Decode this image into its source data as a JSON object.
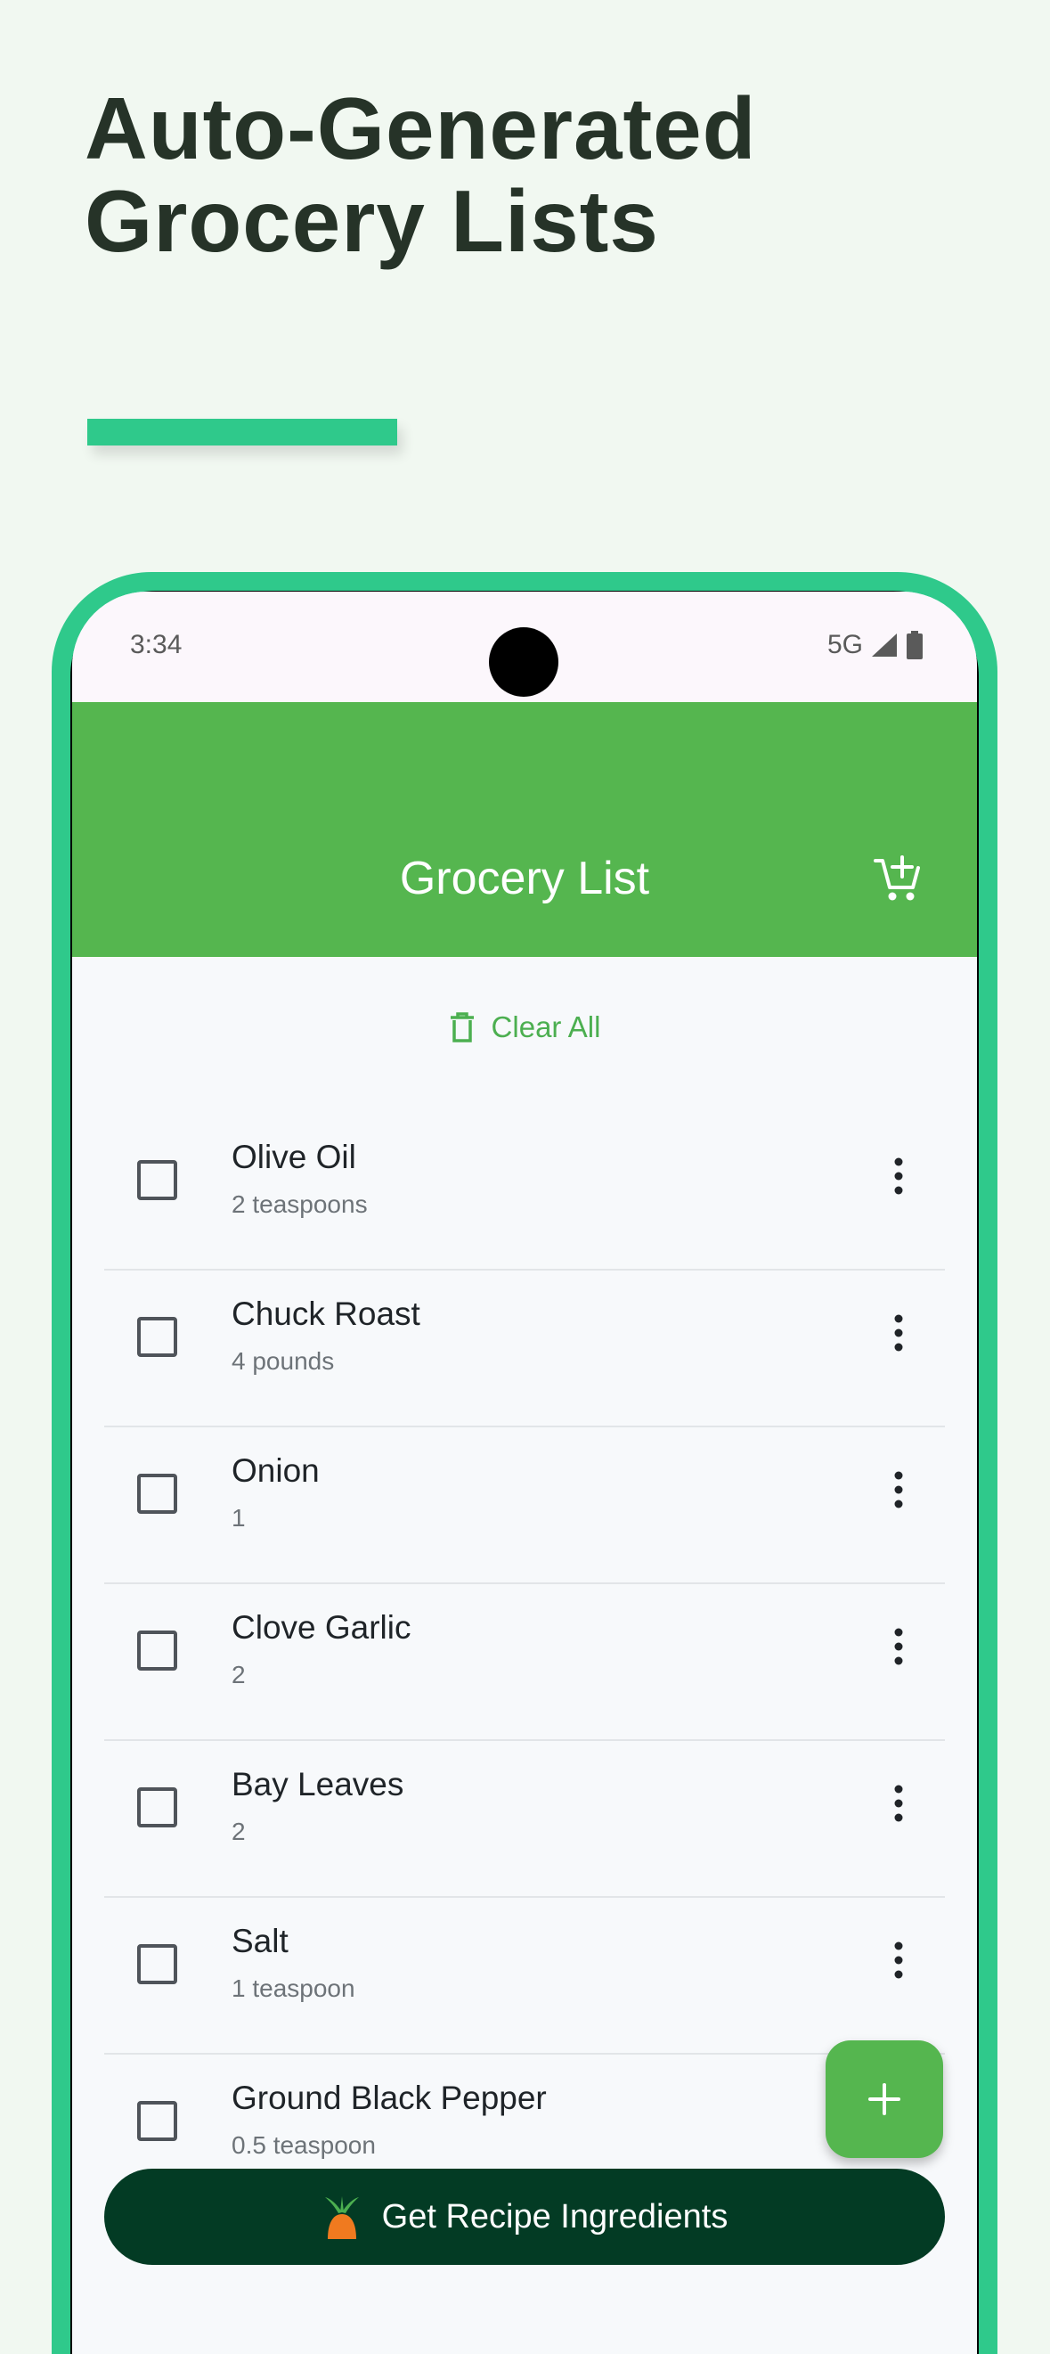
{
  "promo": {
    "title_line1": "Auto-Generated",
    "title_line2": "Grocery Lists"
  },
  "status_bar": {
    "time": "3:34",
    "network": "5G",
    "icons": [
      "signal-icon",
      "battery-icon"
    ]
  },
  "app_bar": {
    "title": "Grocery List",
    "action_icon": "add-cart-icon"
  },
  "clear_all": {
    "label": "Clear All",
    "icon": "trash-icon"
  },
  "items": [
    {
      "name": "Olive Oil",
      "quantity": "2 teaspoons"
    },
    {
      "name": "Chuck Roast",
      "quantity": "4 pounds"
    },
    {
      "name": "Onion",
      "quantity": "1"
    },
    {
      "name": "Clove Garlic",
      "quantity": "2"
    },
    {
      "name": "Bay Leaves",
      "quantity": "2"
    },
    {
      "name": "Salt",
      "quantity": "1 teaspoon"
    },
    {
      "name": "Ground Black Pepper",
      "quantity": "0.5 teaspoon"
    }
  ],
  "fab": {
    "icon": "plus-icon"
  },
  "cta": {
    "label": "Get Recipe Ingredients",
    "icon": "carrot-icon"
  },
  "colors": {
    "accent": "#2fc98b",
    "app_bar": "#55b64f",
    "cta_background": "#033b24",
    "title_text": "#263328"
  }
}
